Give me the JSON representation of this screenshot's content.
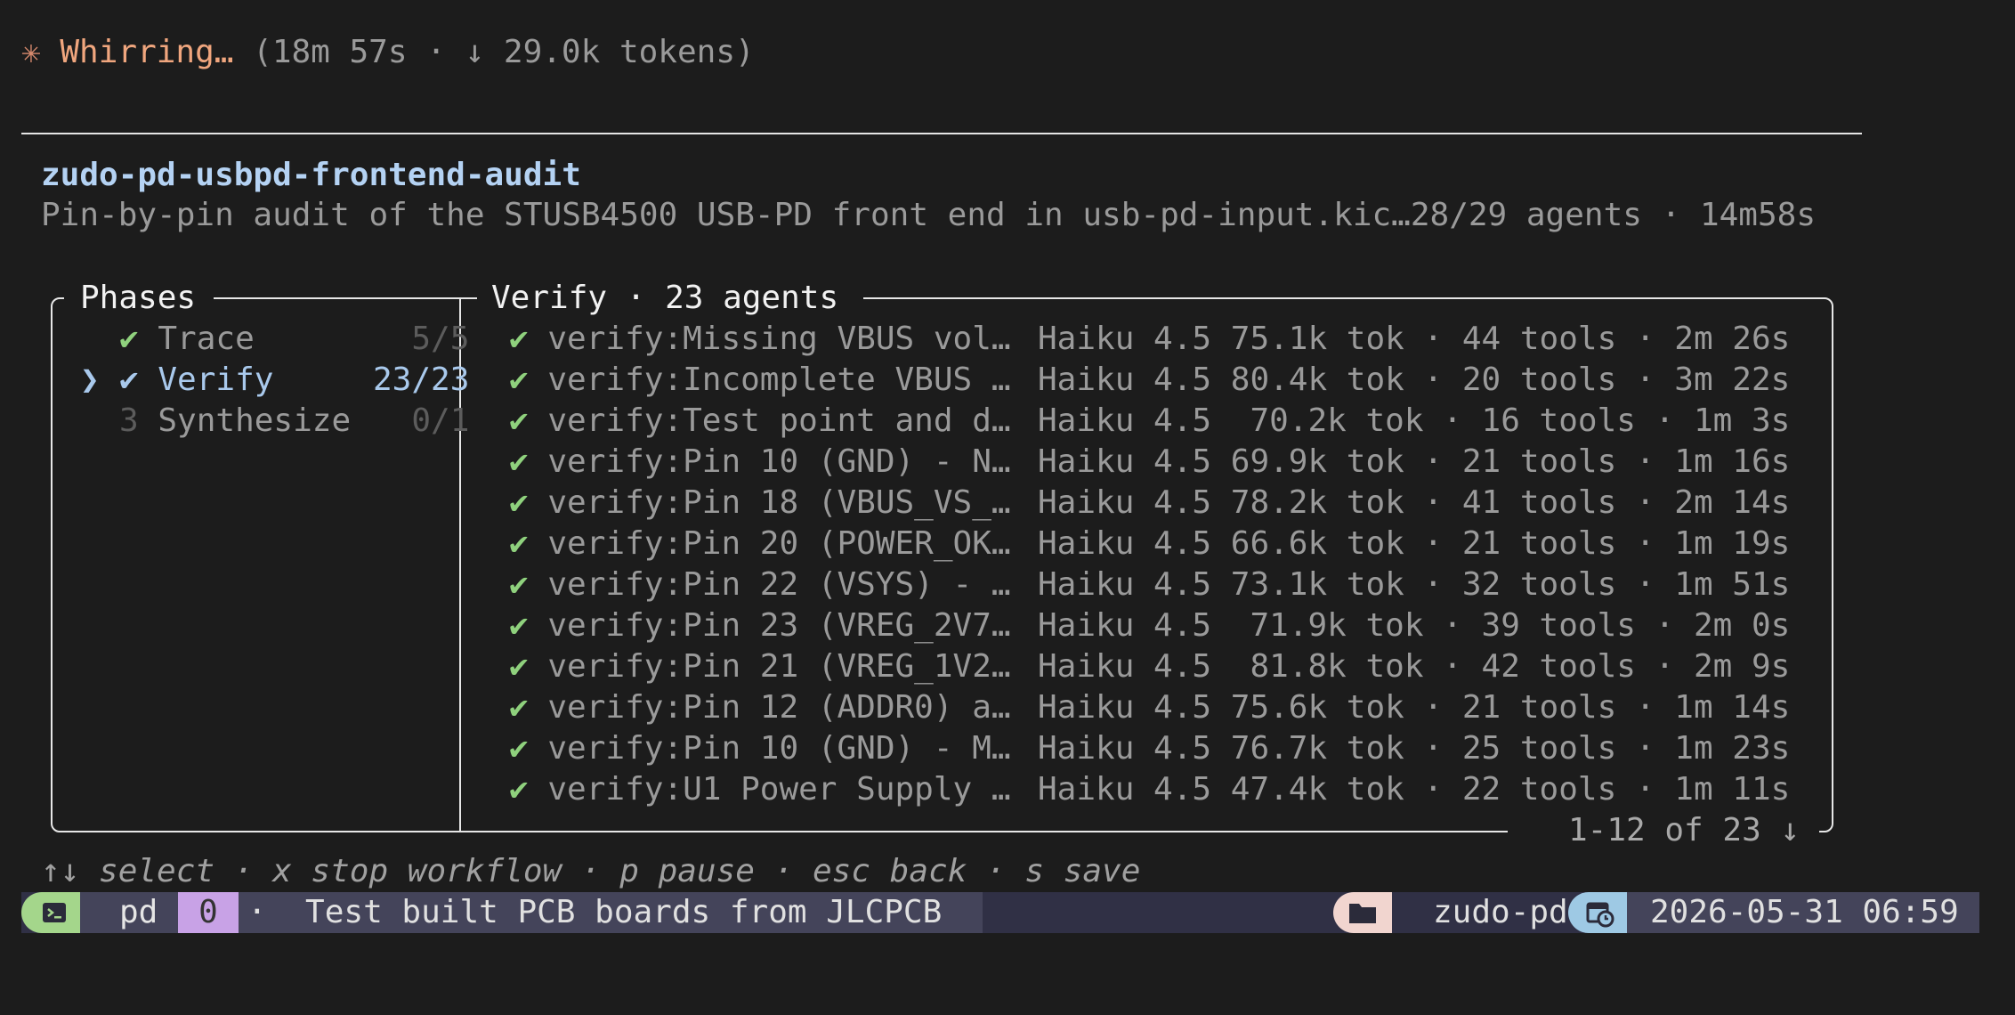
{
  "spinner": {
    "icon": "✳",
    "word": "Whirring…",
    "meta": "(18m 57s · ↓ 29.0k tokens)"
  },
  "workflow": {
    "title": "zudo-pd-usbpd-frontend-audit",
    "description": "Pin-by-pin audit of the STUSB4500 USB-PD front end in usb-pd-input.kic…28/29 agents · 14m58s"
  },
  "phases": {
    "title": "Phases",
    "items": [
      {
        "marker": "",
        "status": "✔",
        "label": "Trace",
        "count": "5/5"
      },
      {
        "marker": "❯",
        "status": "✔",
        "label": "Verify",
        "count": "23/23"
      },
      {
        "marker": "",
        "status": "3",
        "label": "Synthesize",
        "count": "0/1"
      }
    ]
  },
  "agents_panel": {
    "title": "Verify · 23 agents",
    "pager": "1-12 of 23 ↓",
    "agents": [
      {
        "check": "✔",
        "name": "verify:Missing VBUS vol…",
        "model": "Haiku 4.5",
        "stats": "75.1k tok · 44 tools · 2m 26s"
      },
      {
        "check": "✔",
        "name": "verify:Incomplete VBUS …",
        "model": "Haiku 4.5",
        "stats": "80.4k tok · 20 tools · 3m 22s"
      },
      {
        "check": "✔",
        "name": "verify:Test point and d…",
        "model": "Haiku 4.5",
        "stats": " 70.2k tok · 16 tools · 1m 3s"
      },
      {
        "check": "✔",
        "name": "verify:Pin 10 (GND) - N…",
        "model": "Haiku 4.5",
        "stats": "69.9k tok · 21 tools · 1m 16s"
      },
      {
        "check": "✔",
        "name": "verify:Pin 18 (VBUS_VS_…",
        "model": "Haiku 4.5",
        "stats": "78.2k tok · 41 tools · 2m 14s"
      },
      {
        "check": "✔",
        "name": "verify:Pin 20 (POWER_OK…",
        "model": "Haiku 4.5",
        "stats": "66.6k tok · 21 tools · 1m 19s"
      },
      {
        "check": "✔",
        "name": "verify:Pin 22 (VSYS) - …",
        "model": "Haiku 4.5",
        "stats": "73.1k tok · 32 tools · 1m 51s"
      },
      {
        "check": "✔",
        "name": "verify:Pin 23 (VREG_2V7…",
        "model": "Haiku 4.5",
        "stats": " 71.9k tok · 39 tools · 2m 0s"
      },
      {
        "check": "✔",
        "name": "verify:Pin 21 (VREG_1V2…",
        "model": "Haiku 4.5",
        "stats": " 81.8k tok · 42 tools · 2m 9s"
      },
      {
        "check": "✔",
        "name": "verify:Pin 12 (ADDR0) a…",
        "model": "Haiku 4.5",
        "stats": "75.6k tok · 21 tools · 1m 14s"
      },
      {
        "check": "✔",
        "name": "verify:Pin 10 (GND) - M…",
        "model": "Haiku 4.5",
        "stats": "76.7k tok · 25 tools · 1m 23s"
      },
      {
        "check": "✔",
        "name": "verify:U1 Power Supply …",
        "model": "Haiku 4.5",
        "stats": "47.4k tok · 22 tools · 1m 11s"
      }
    ]
  },
  "hints": "↑↓ select · x stop workflow · p pause · esc back · s save",
  "statusbar": {
    "session": "pd",
    "window_index": "0",
    "window_dot": "·",
    "task": "Test built PCB boards from JLCPCB",
    "folder": "zudo-pd",
    "datetime": "2026-05-31 06:59",
    "icons": {
      "terminal": "terminal-icon",
      "folder": "folder-icon",
      "calendar": "calendar-clock-icon"
    },
    "colors": {
      "accent_green": "#a4d68b",
      "accent_purple": "#c8a2e6",
      "accent_peach": "#f1d5cf",
      "accent_blue": "#9ec9e4"
    }
  }
}
